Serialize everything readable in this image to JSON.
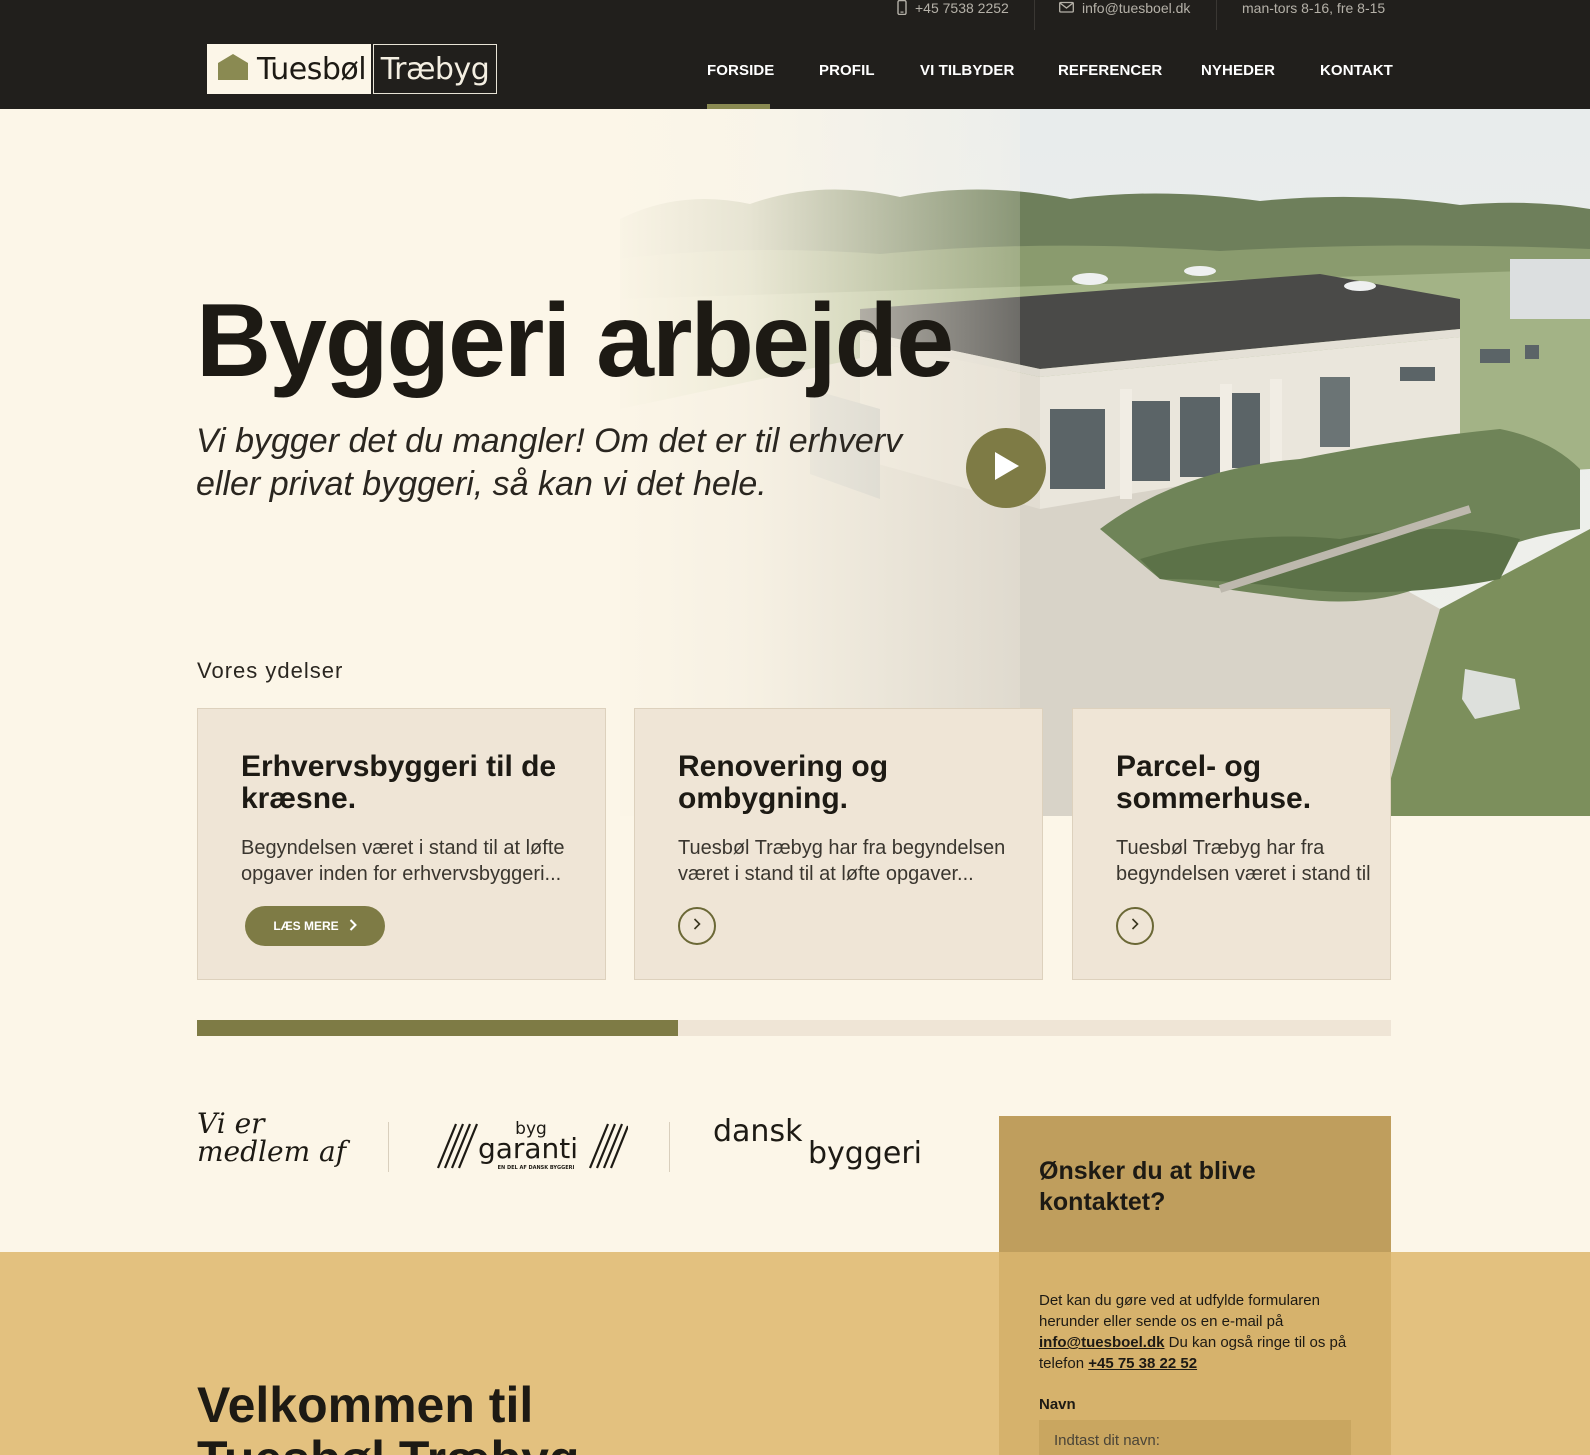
{
  "topbar": {
    "phone": "+45 7538 2252",
    "email": "info@tuesboel.dk",
    "hours": "man-tors 8-16, fre 8-15"
  },
  "logo": {
    "left": "Tuesbøl",
    "right": "Træbyg"
  },
  "nav": {
    "items": [
      "FORSIDE",
      "PROFIL",
      "VI TILBYDER",
      "REFERENCER",
      "NYHEDER",
      "KONTAKT"
    ],
    "active": "FORSIDE"
  },
  "hero": {
    "title": "Byggeri arbejde",
    "subtitle": "Vi bygger det du mangler! Om det er til erhverv eller privat byggeri, så kan vi det hele."
  },
  "services": {
    "label": "Vores ydelser",
    "cards": [
      {
        "title": "Erhvervsbyggeri til de kræsne.",
        "text": "Begyndelsen været i stand til at løfte opgaver inden for erhvervsbyggeri...",
        "button": "LÆS MERE"
      },
      {
        "title": "Renovering og ombygning.",
        "text": "Tuesbøl Træbyg har fra begyndelsen været i stand til at løfte opgaver..."
      },
      {
        "title": "Parcel- og sommerhuse.",
        "text": "Tuesbøl Træbyg har fra begyndelsen været i stand til"
      }
    ],
    "progress_fraction": 0.403
  },
  "members": {
    "label": "Vi er medlem af",
    "byggaranti_top": "byg",
    "byggaranti_main": "garanti",
    "byggaranti_sub": "EN DEL AF DANSK BYGGERI",
    "dansk_top": "dansk",
    "dansk_bottom": "byggeri"
  },
  "welcome": {
    "line1": "Velkommen til",
    "line2": "Tuesbøl Træbyg"
  },
  "contact": {
    "title": "Ønsker du at blive kontaktet?",
    "text_before": "Det kan du gøre ved at udfylde formularen herunder eller sende os en e-mail på ",
    "email": "info@tuesboel.dk",
    "text_middle": " Du kan også ringe til os på telefon ",
    "phone": "+45 75 38 22 52",
    "name_label": "Navn",
    "name_placeholder": "Indtast dit navn:"
  },
  "colors": {
    "dark": "#211f1c",
    "cream": "#fcf6e8",
    "olive": "#7e7b45",
    "card": "#efe5d6",
    "gold": "#e3c17f",
    "gold_dark": "#bf9e5d"
  }
}
